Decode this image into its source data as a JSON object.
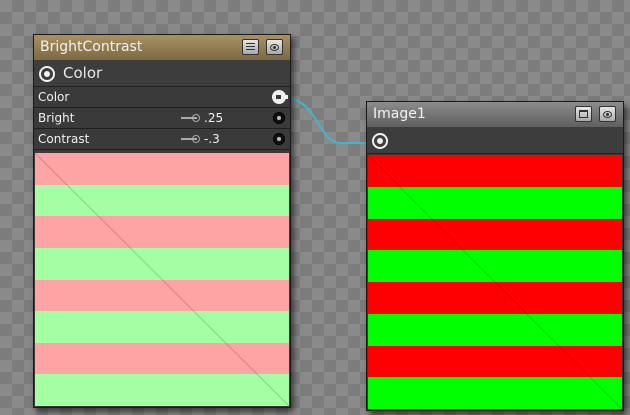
{
  "nodes": {
    "bright_contrast": {
      "title": "BrightContrast",
      "output_label": "Color",
      "params": [
        {
          "label": "Color",
          "value": "",
          "kind": "input"
        },
        {
          "label": "Bright",
          "value": ".25",
          "kind": "value"
        },
        {
          "label": "Contrast",
          "value": "-.3",
          "kind": "value"
        }
      ],
      "preview_colors": [
        "#ffa4a4",
        "#a4ffa4"
      ]
    },
    "image1": {
      "title": "Image1",
      "output_label": "",
      "preview_colors": [
        "#ff0000",
        "#00ff00"
      ]
    }
  },
  "icons": {
    "output": "output-eye-icon",
    "menu": "list-menu-icon",
    "eye": "visibility-eye-icon",
    "window": "window-icon",
    "key": "key-icon",
    "connector": "connector-dot-icon"
  },
  "colors": {
    "wire": "#3fb7d1",
    "bc_title": "#8f7a4e",
    "img_title": "#707070"
  }
}
